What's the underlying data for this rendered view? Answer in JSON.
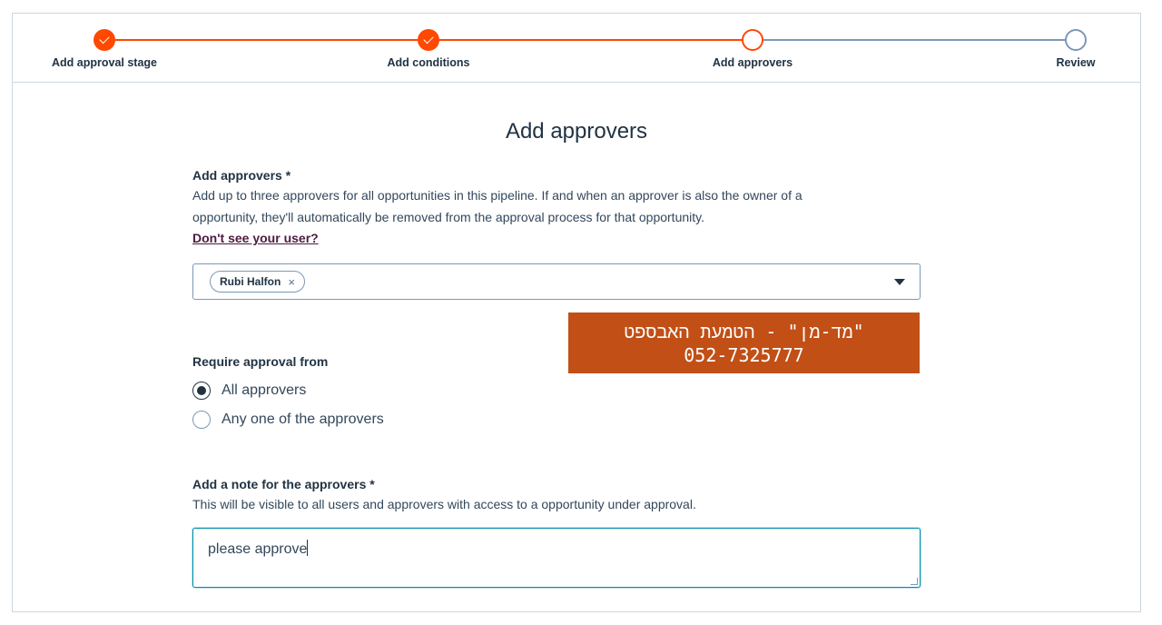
{
  "stepper": {
    "steps": [
      {
        "label": "Add approval stage",
        "state": "done"
      },
      {
        "label": "Add conditions",
        "state": "done"
      },
      {
        "label": "Add approvers",
        "state": "current"
      },
      {
        "label": "Review",
        "state": "todo"
      }
    ]
  },
  "page": {
    "title": "Add approvers"
  },
  "approvers": {
    "label": "Add approvers *",
    "help_line1": "Add up to three approvers for all opportunities in this pipeline. If and when an approver is also the owner of a",
    "help_line2": "opportunity, they'll automatically be removed from the approval process for that opportunity.",
    "link": "Don't see your user?",
    "selected": [
      {
        "name": "Rubi Halfon",
        "remove": "×"
      }
    ]
  },
  "banner": {
    "line1": "\"מד-מן\" - הטמעת האבספט",
    "line2": "052-7325777"
  },
  "require": {
    "label": "Require approval from",
    "options": [
      {
        "label": "All approvers",
        "checked": true
      },
      {
        "label": "Any one of the approvers",
        "checked": false
      }
    ]
  },
  "note": {
    "label": "Add a note for the approvers *",
    "help": "This will be visible to all users and approvers with access to a opportunity under approval.",
    "value": "please approve"
  },
  "colors": {
    "accent": "#ff4800",
    "banner": "#c14f16",
    "focus": "#0091ae"
  }
}
